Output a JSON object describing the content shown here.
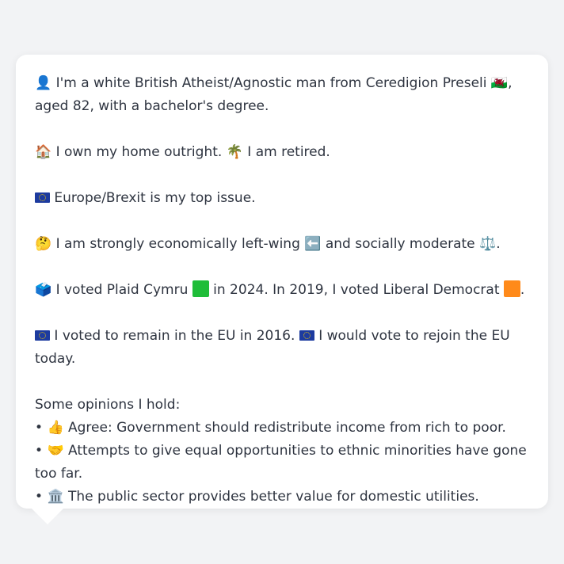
{
  "profile": {
    "intro": {
      "icon": "bust-silhouette-icon",
      "text_1": "I'm a white British Atheist/Agnostic man from Ceredigion Preseli",
      "flag": "wales-flag-icon",
      "text_2": ", aged 82, with a bachelor's degree."
    },
    "housing": {
      "icon_home": "house-icon",
      "text_1": "I own my home outright.",
      "icon_retired": "palm-tree-icon",
      "text_2": "I am retired."
    },
    "top_issue": {
      "icon": "eu-flag-icon",
      "text": "Europe/Brexit is my top issue."
    },
    "ideology": {
      "icon": "thinking-face-icon",
      "text_1": "I am strongly economically left-wing",
      "icon_left": "left-arrow-icon",
      "text_2": "and socially moderate",
      "icon_scales": "balance-scale-icon",
      "text_3": "."
    },
    "votes": {
      "icon": "ballot-box-icon",
      "text_1": "I voted Plaid Cymru",
      "color_plaid": "#1fbd39",
      "text_2": "in 2024. In 2019, I voted Liberal Democrat",
      "color_libdem": "#ff8a1a",
      "text_3": "."
    },
    "eu": {
      "icon_1": "eu-flag-icon",
      "text_1": "I voted to remain in the EU in 2016.",
      "icon_2": "eu-flag-icon",
      "text_2": "I would vote to rejoin the EU today."
    },
    "opinions": {
      "heading": "Some opinions I hold:",
      "bullet": "•",
      "items": [
        {
          "icon": "thumbs-up-icon",
          "glyph": "👍",
          "text": "Agree: Government should redistribute income from rich to poor."
        },
        {
          "icon": "handshake-icon",
          "glyph": "🤝",
          "text": "Attempts to give equal opportunities to ethnic minorities have gone too far."
        },
        {
          "icon": "classical-building-icon",
          "glyph": "🏛️",
          "text": "The public sector provides better value for domestic utilities."
        }
      ]
    }
  },
  "glyphs": {
    "bust": "👤",
    "wales": "🏴󠁧󠁢󠁷󠁬󠁳󠁿",
    "house": "🏠",
    "palm": "🌴",
    "thinking": "🤔",
    "left_arrow": "⬅️",
    "scales": "⚖️",
    "ballot": "🗳️"
  }
}
